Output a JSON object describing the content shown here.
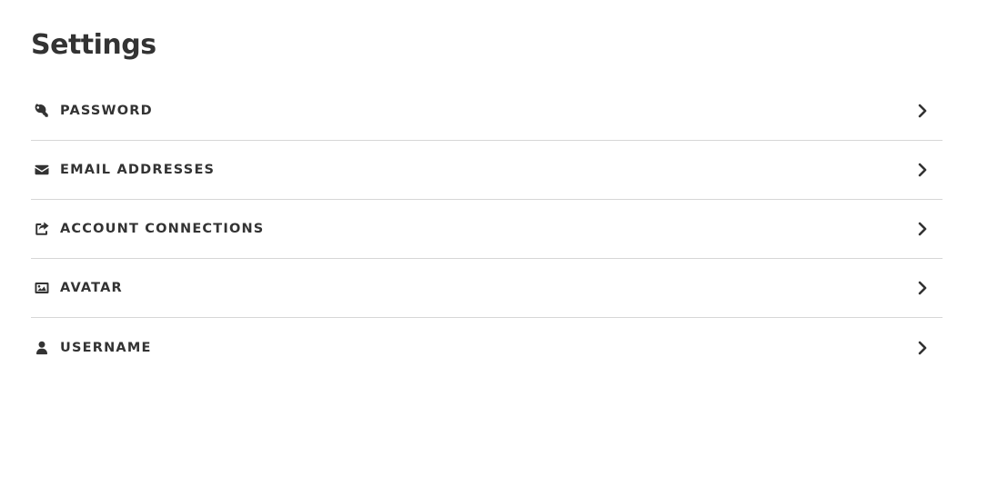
{
  "page": {
    "title": "Settings"
  },
  "settings": {
    "items": [
      {
        "label": "PASSWORD",
        "icon": "key-icon",
        "name": "password"
      },
      {
        "label": "EMAIL ADDRESSES",
        "icon": "envelope-icon",
        "name": "email-addresses"
      },
      {
        "label": "ACCOUNT CONNECTIONS",
        "icon": "share-icon",
        "name": "account-connections"
      },
      {
        "label": "AVATAR",
        "icon": "image-icon",
        "name": "avatar"
      },
      {
        "label": "USERNAME",
        "icon": "user-icon",
        "name": "username"
      }
    ],
    "chevron_icon": "chevron-right-icon"
  },
  "colors": {
    "text": "#333333",
    "divider": "#d6d6d6",
    "background": "#ffffff"
  }
}
